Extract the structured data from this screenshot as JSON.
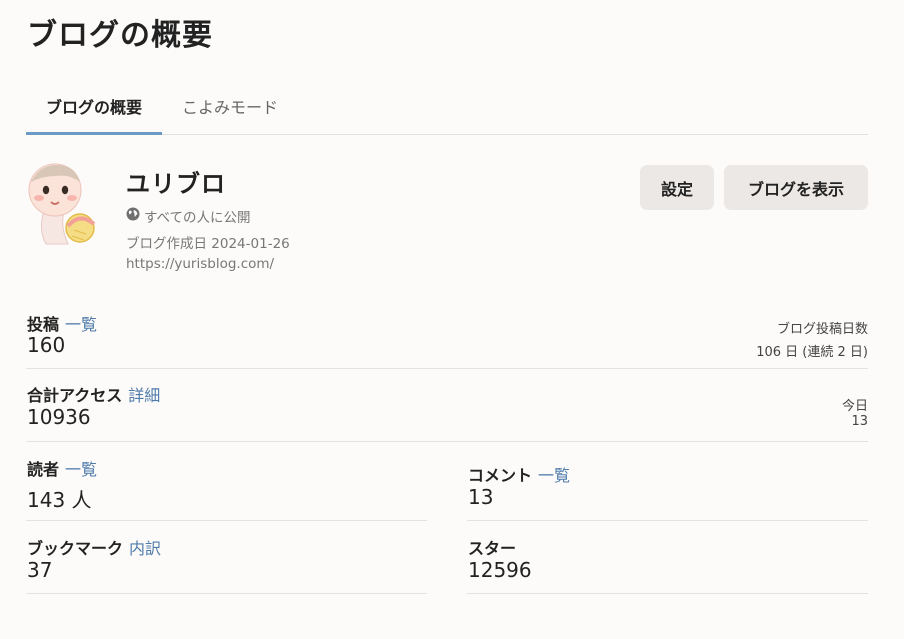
{
  "page": {
    "title": "ブログの概要"
  },
  "tabs": [
    {
      "label": "ブログの概要",
      "active": true
    },
    {
      "label": "こよみモード",
      "active": false
    }
  ],
  "blog": {
    "name": "ユリブロ",
    "visibility": "すべての人に公開",
    "created": "ブログ作成日 2024-01-26",
    "url": "https://yurisblog.com/"
  },
  "buttons": {
    "settings": "設定",
    "view_blog": "ブログを表示"
  },
  "stats": {
    "posts": {
      "label": "投稿",
      "link": "一覧",
      "value": "160",
      "side_label": "ブログ投稿日数",
      "side_value": "106 日 (連続 2 日)"
    },
    "access": {
      "label": "合計アクセス",
      "link": "詳細",
      "value": "10936",
      "side_label": "今日",
      "side_value": "13"
    },
    "readers": {
      "label": "読者",
      "link": "一覧",
      "value": "143 人"
    },
    "comments": {
      "label": "コメント",
      "link": "一覧",
      "value": "13"
    },
    "bookmarks": {
      "label": "ブックマーク",
      "link": "内訳",
      "value": "37"
    },
    "stars": {
      "label": "スター",
      "value": "12596"
    }
  },
  "colors": {
    "accent": "#6a9bc4",
    "link": "#4f7bab",
    "background": "#fcfbf9",
    "button_bg": "#ece8e5"
  },
  "icons": {
    "visibility": "globe-icon"
  }
}
